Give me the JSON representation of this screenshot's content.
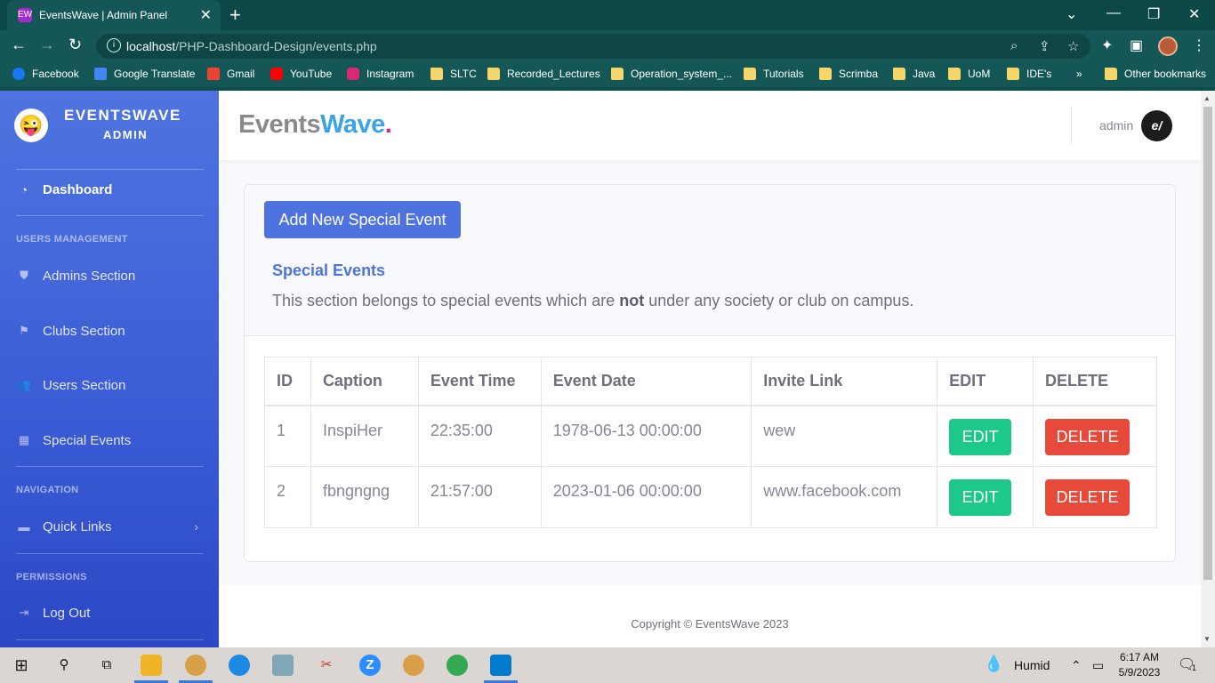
{
  "browser": {
    "tab_title": "EventsWave | Admin Panel",
    "tab_favicon": "EW",
    "url_host": "localhost",
    "url_path": "/PHP-Dashboard-Design/events.php",
    "bookmarks": [
      "Facebook",
      "Google Translate",
      "Gmail",
      "YouTube",
      "Instagram",
      "SLTC",
      "Recorded_Lectures",
      "Operation_system_...",
      "Tutorials",
      "Scrimba",
      "Java",
      "UoM",
      "IDE's",
      "Other bookmarks"
    ],
    "overflow_label": "»"
  },
  "sidebar": {
    "brand_name": "EVENTSWAVE",
    "brand_sub": "ADMIN",
    "dashboard": "Dashboard",
    "heading_users": "USERS MANAGEMENT",
    "admins": "Admins Section",
    "clubs": "Clubs Section",
    "users": "Users Section",
    "special_events": "Special Events",
    "heading_navigation": "NAVIGATION",
    "quick_links": "Quick Links",
    "heading_permissions": "PERMISSIONS",
    "logout": "Log Out"
  },
  "topbar": {
    "logo_part1": "Events",
    "logo_part2": "Wave",
    "logo_dot": ".",
    "username": "admin",
    "avatar_text": "e/"
  },
  "main": {
    "add_button": "Add New Special Event",
    "section_title": "Special Events",
    "desc_before": "This section belongs to special events which are ",
    "desc_bold": "not",
    "desc_after": " under any society or club on campus.",
    "table": {
      "headers": [
        "ID",
        "Caption",
        "Event Time",
        "Event Date",
        "Invite Link",
        "EDIT",
        "DELETE"
      ],
      "rows": [
        {
          "id": "1",
          "caption": "InspiHer",
          "time": "22:35:00",
          "date": "1978-06-13 00:00:00",
          "link": "wew",
          "edit": "EDIT",
          "delete": "DELETE"
        },
        {
          "id": "2",
          "caption": "fbngngng",
          "time": "21:57:00",
          "date": "2023-01-06 00:00:00",
          "link": "www.facebook.com",
          "edit": "EDIT",
          "delete": "DELETE"
        }
      ]
    }
  },
  "footer": {
    "copyright": "Copyright © EventsWave 2023"
  },
  "taskbar": {
    "weather": "Humid",
    "time": "6:17 AM",
    "date": "5/9/2023",
    "notifications": "1"
  },
  "colors": {
    "primary": "#4e73df",
    "success": "#1cc88a",
    "danger": "#e74a3b",
    "browser_chrome": "#155757"
  }
}
